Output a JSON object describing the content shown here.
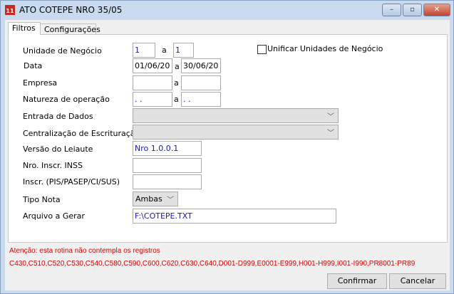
{
  "window": {
    "title": "ATO COTEPE NRO 35/05",
    "icon_text": "11",
    "minimize": "–",
    "maximize": "▫",
    "close": "✕"
  },
  "tabs": [
    {
      "label": "Filtros"
    },
    {
      "label": "Configurações"
    }
  ],
  "form": {
    "unidade": {
      "label": "Unidade de Negócio",
      "from": "1",
      "sep": "a",
      "to": "1"
    },
    "unificar": {
      "label": "Unificar Unidades de Negócio",
      "checked": false
    },
    "data": {
      "label": "Data",
      "from": "01/06/20",
      "sep": "a",
      "to": "30/06/20"
    },
    "empresa": {
      "label": "Empresa",
      "from": "",
      "sep": "a",
      "to": ""
    },
    "natureza": {
      "label": "Natureza de operação",
      "from": ". .",
      "sep": "a",
      "to": ". ."
    },
    "entrada": {
      "label": "Entrada de Dados",
      "value": ""
    },
    "centralizacao": {
      "label": "Centralização de Escrituração",
      "value": ""
    },
    "versao": {
      "label": "Versão do Leiaute",
      "value": "Nro 1.0.0.1"
    },
    "inss": {
      "label": "Nro. Inscr. INSS",
      "value": ""
    },
    "inscr": {
      "label": "Inscr. (PIS/PASEP/CI/SUS)",
      "value": ""
    },
    "tipo_nota": {
      "label": "Tipo Nota",
      "value": "Ambas"
    },
    "arquivo": {
      "label": "Arquivo a Gerar",
      "value": "F:\\COTEPE.TXT"
    }
  },
  "warning": {
    "line1": "Atenção: esta rotina não contempla os registros",
    "line2": "C430,C510,C520,C530,C540,C580,C590,C600,C620,C630,C640,D001-D999,E0001-E999,H001-H999,I001-I990,PR8001-PR89"
  },
  "buttons": {
    "confirm": "Confirmar",
    "cancel": "Cancelar"
  },
  "colors": {
    "warning": "#e00000",
    "value_text": "#1a1aa8"
  }
}
